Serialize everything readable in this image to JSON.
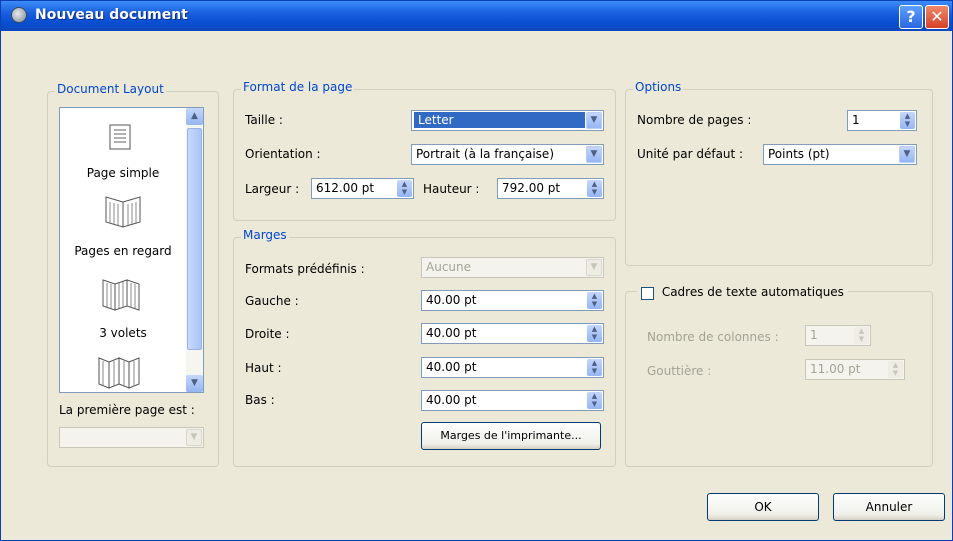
{
  "window": {
    "title": "Nouveau document",
    "help_label": "?",
    "close_label": "✕"
  },
  "document_layout": {
    "legend": "Document Layout",
    "items": [
      {
        "label": "Page simple",
        "icon": "single-page-icon"
      },
      {
        "label": "Pages en regard",
        "icon": "facing-pages-icon"
      },
      {
        "label": "3 volets",
        "icon": "three-fold-icon"
      },
      {
        "label": "",
        "icon": "four-fold-icon"
      }
    ],
    "first_page_label": "La première page est :",
    "first_page_value": ""
  },
  "page_format": {
    "legend": "Format de la page",
    "size_label": "Taille :",
    "size_value": "Letter",
    "orientation_label": "Orientation :",
    "orientation_value": "Portrait (à la française)",
    "width_label": "Largeur :",
    "width_value": "612.00 pt",
    "height_label": "Hauteur :",
    "height_value": "792.00 pt"
  },
  "margins": {
    "legend": "Marges",
    "presets_label": "Formats prédéfinis :",
    "presets_value": "Aucune",
    "left_label": "Gauche :",
    "left_value": "40.00 pt",
    "right_label": "Droite :",
    "right_value": "40.00 pt",
    "top_label": "Haut :",
    "top_value": "40.00 pt",
    "bottom_label": "Bas :",
    "bottom_value": "40.00 pt",
    "printer_button": "Marges de l'imprimante..."
  },
  "options": {
    "legend": "Options",
    "pages_label": "Nombre de pages :",
    "pages_value": "1",
    "unit_label": "Unité par défaut :",
    "unit_value": "Points (pt)"
  },
  "auto_frames": {
    "checkbox_label": "Cadres de texte automatiques",
    "checked": false,
    "columns_label": "Nombre de colonnes :",
    "columns_value": "1",
    "gutter_label": "Gouttière :",
    "gutter_value": "11.00 pt"
  },
  "buttons": {
    "ok": "OK",
    "cancel": "Annuler"
  },
  "colors": {
    "title_bar": "#0a4fd2",
    "group_legend": "#0046d5",
    "dialog_bg": "#ece9d8"
  }
}
